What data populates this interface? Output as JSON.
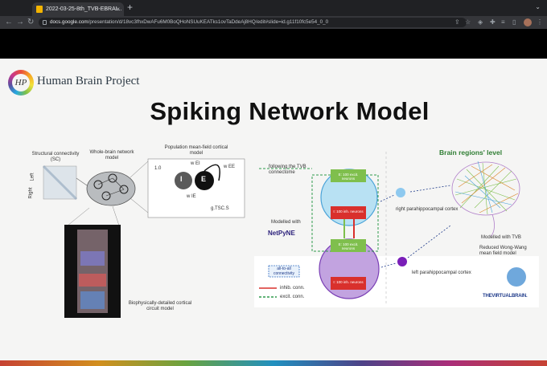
{
  "browser": {
    "tab_title": "2022-03-25-8th_TVB-EBRAI...",
    "tab_close": "×",
    "new_tab": "+",
    "url_host": "docs.google.com",
    "url_path": "/presentation/d/18vc3fhxDwAFu6M0BoQHoNSUuKEATks1ovTaDdeAj8HQ/edit#slide=id.g11f10fc5e54_0_0",
    "back": "←",
    "forward": "→",
    "reload": "↻",
    "window_menu": "⌄"
  },
  "slide": {
    "logo_letters": "HP",
    "org_name": "Human Brain Project",
    "title": "Spiking Network Model"
  },
  "left_figure": {
    "sc_label": "Structural connectivity (SC)",
    "sc_axis_right": "Right",
    "sc_axis_left": "Left",
    "network_label": "Whole-brain network model",
    "meanfield_label": "Population mean-field cortical model",
    "node_i": "I",
    "node_e": "E",
    "w_ei": "w EI",
    "w_ie": "w IE",
    "w_ee": "w EE",
    "scale": "1.0",
    "g_formula": "g.TSC.S",
    "circuit_label": "Biophysically-detailed cortical circuit model"
  },
  "right_figure": {
    "following_label": "following the TVB connectome",
    "brain_regions_label": "Brain regions' level",
    "modelled_with": "Modelled with",
    "netpyne": "NetPyNE",
    "exc_neurons_top": "E: 100 excit. neurons",
    "inh_neurons_top": "I: 100 inh. neurons",
    "exc_neurons_bottom": "E: 100 excit. neurons",
    "inh_neurons_bottom": "I: 100 inh. neurons",
    "right_cortex": "right parahippocampal cortex",
    "left_cortex": "left parahippocampal cortex",
    "modelled_tvb": "Modelled with TVB",
    "reduced_model": "Reduced Wong-Wang mean field model",
    "legend_all": "all-to-all connectivity",
    "legend_inhib": "inhib. conn.",
    "legend_excit": "excit. conn.",
    "tvb_logo": "THEVIRTUALBRAIN.",
    "colors": {
      "exc": "#7fbf4d",
      "inh": "#d9302c",
      "top_pop": "#8fd0ee",
      "bottom_pop": "#b08ad6",
      "node_right": "#8ec9ef",
      "node_left": "#7a1fb8"
    }
  }
}
